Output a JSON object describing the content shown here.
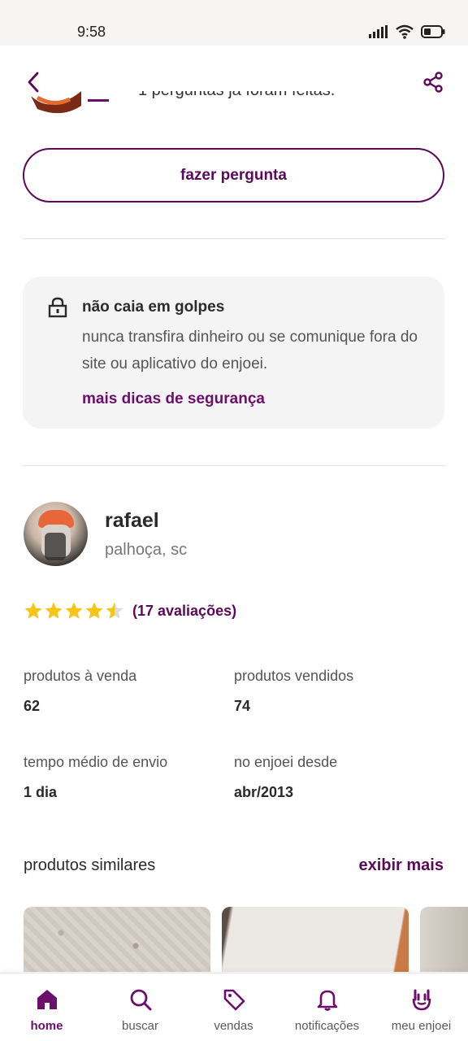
{
  "status_bar": {
    "time": "9:58"
  },
  "header": {
    "partial_text": "1 perguntas já foram feitas."
  },
  "question": {
    "button_label": "fazer pergunta"
  },
  "safety": {
    "title": "não caia em golpes",
    "text": "nunca transfira dinheiro ou se comunique fora do site ou aplicativo do enjoei.",
    "link": "mais dicas de segurança"
  },
  "seller": {
    "name": "rafael",
    "location": "palhoça, sc",
    "rating": 4.5,
    "rating_text": "(17 avaliações)",
    "stats": [
      {
        "label": "produtos à venda",
        "value": "62"
      },
      {
        "label": "produtos vendidos",
        "value": "74"
      },
      {
        "label": "tempo médio de envio",
        "value": "1 dia"
      },
      {
        "label": "no enjoei desde",
        "value": "abr/2013"
      }
    ]
  },
  "similar": {
    "title": "produtos similares",
    "more": "exibir mais"
  },
  "nav": {
    "items": [
      {
        "label": "home",
        "icon": "home-icon",
        "active": true
      },
      {
        "label": "buscar",
        "icon": "search-icon"
      },
      {
        "label": "vendas",
        "icon": "tag-icon"
      },
      {
        "label": "notificações",
        "icon": "bell-icon"
      },
      {
        "label": "meu enjoei",
        "icon": "hand-icon"
      }
    ]
  },
  "colors": {
    "brand": "#5b0a5b",
    "star": "#f5c518"
  }
}
